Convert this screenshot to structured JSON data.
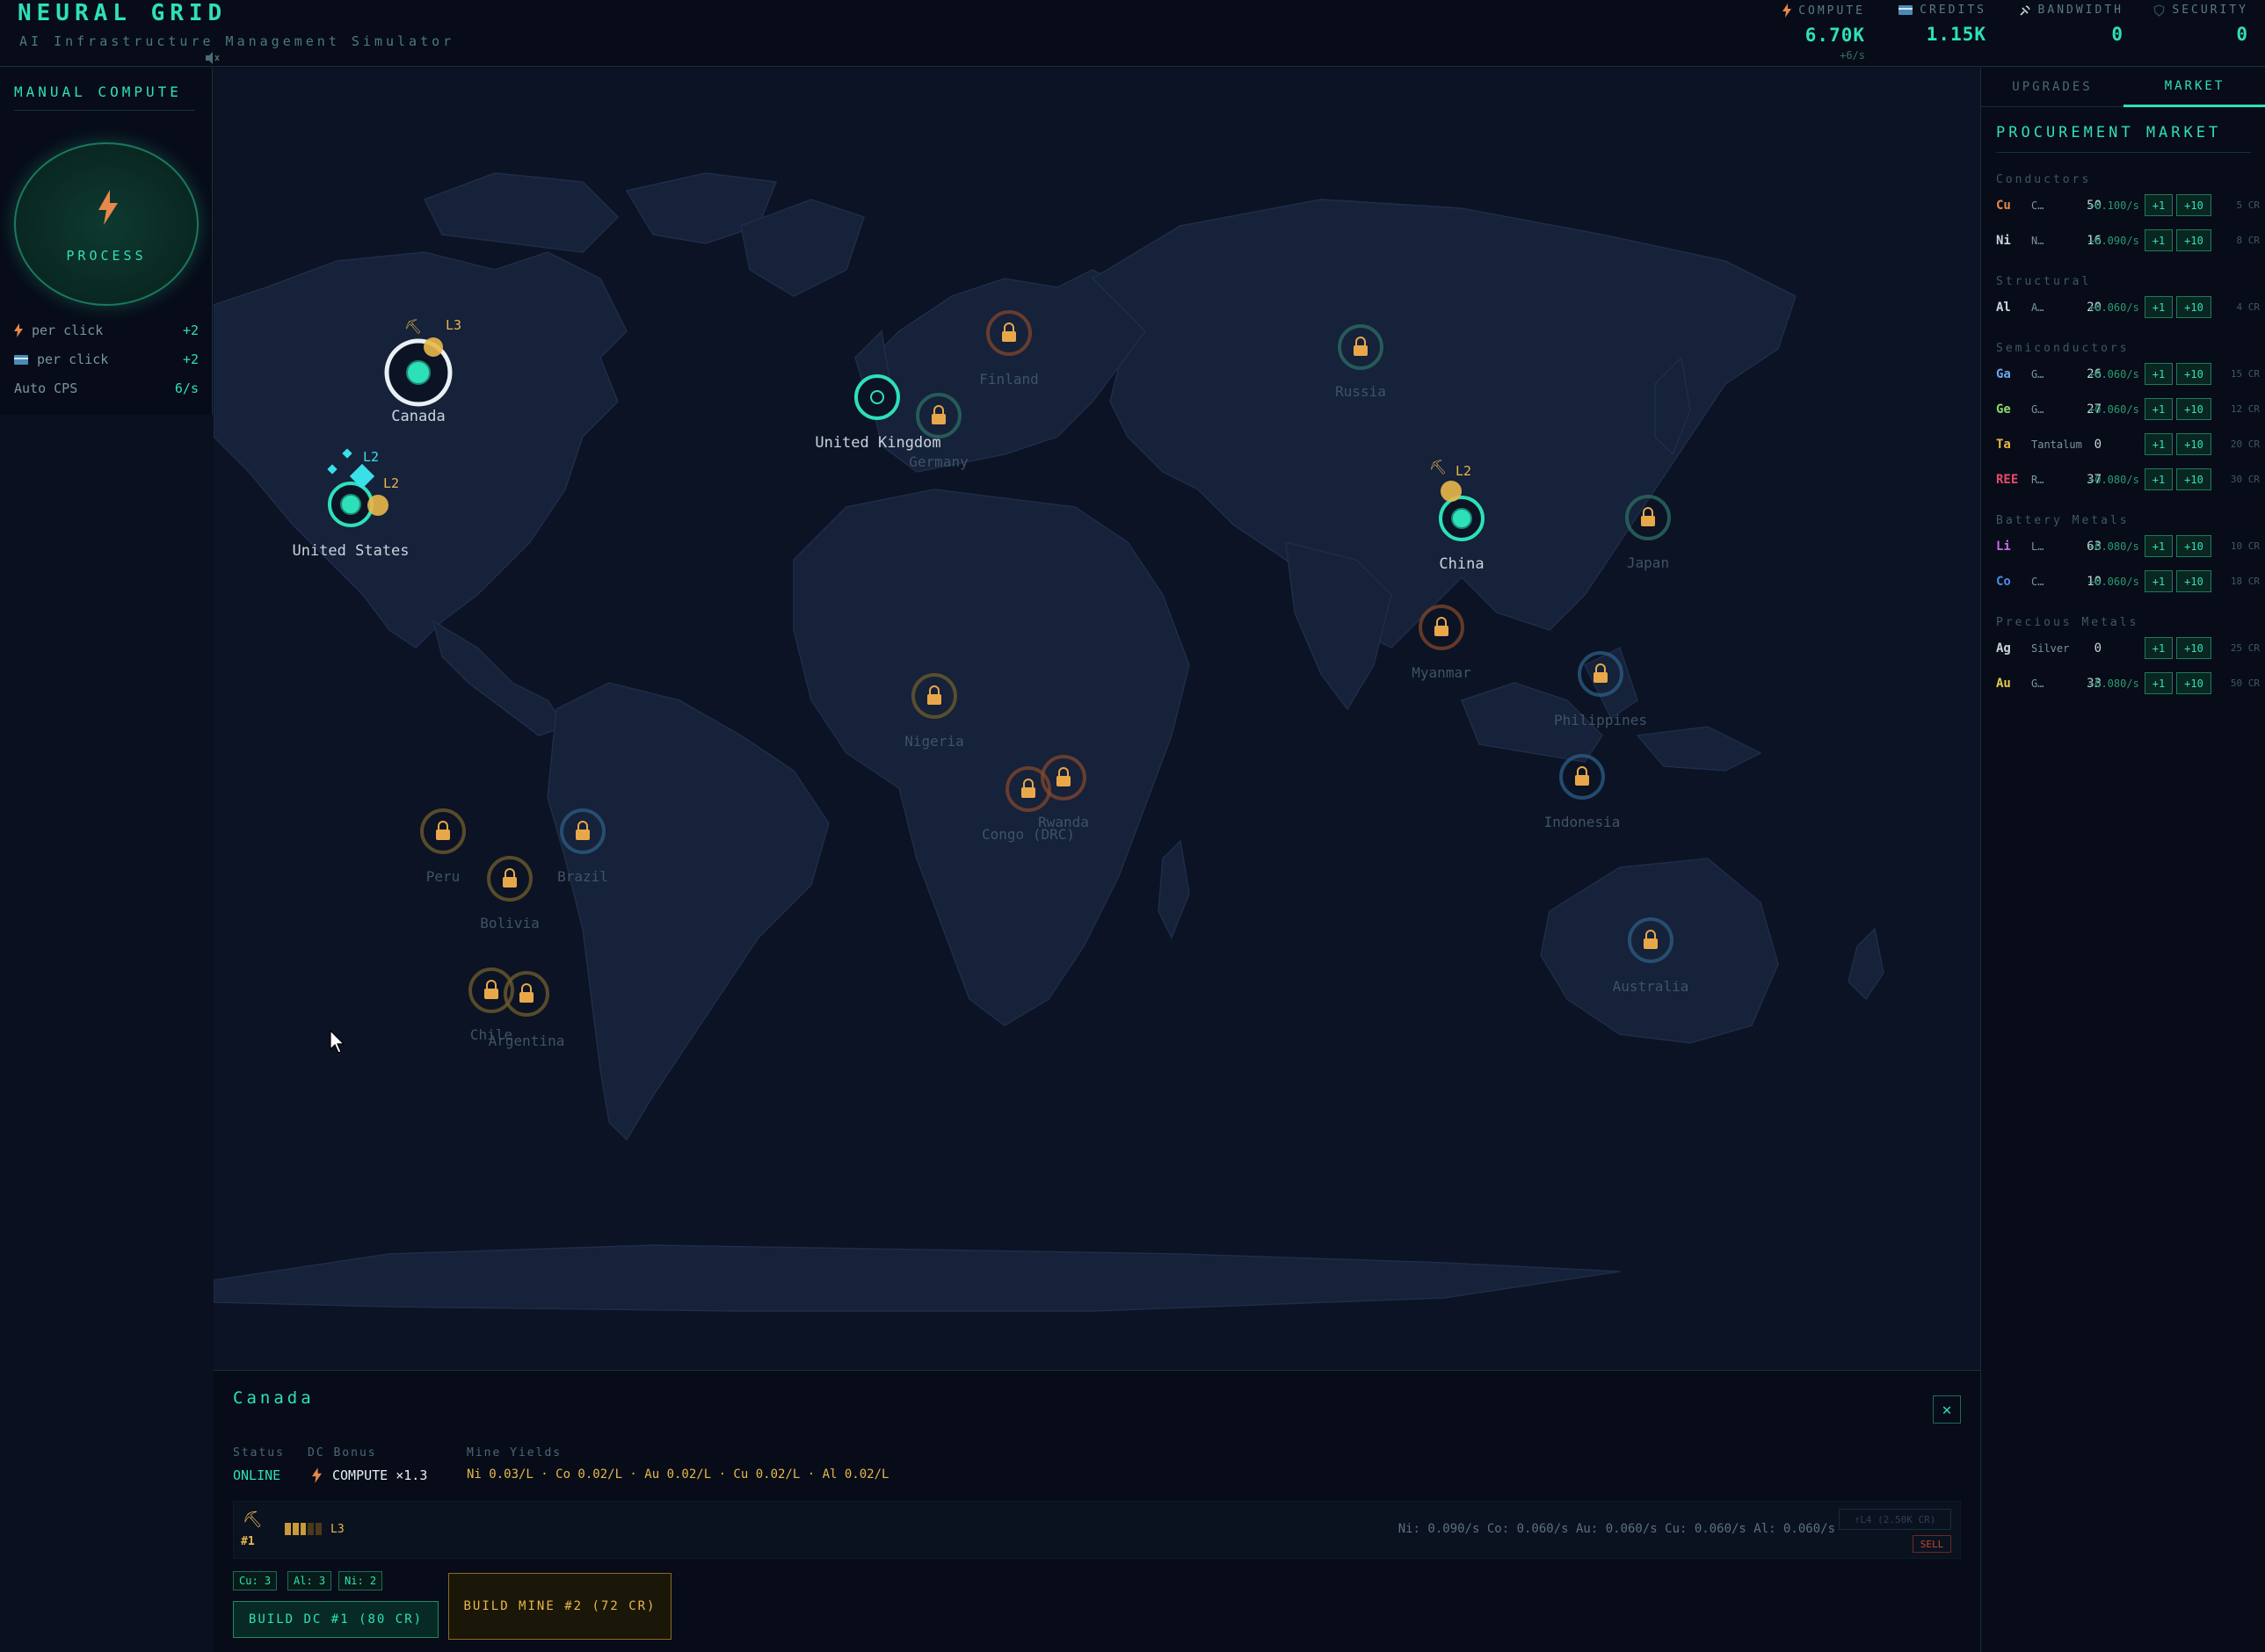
{
  "header": {
    "title": "NEURAL GRID",
    "subtitle": "AI Infrastructure Management Simulator",
    "stats": [
      {
        "label": "COMPUTE",
        "value": "6.70K",
        "sub": "+6/s",
        "icon": "lightning-icon"
      },
      {
        "label": "CREDITS",
        "value": "1.15K",
        "sub": "",
        "icon": "card-icon"
      },
      {
        "label": "BANDWIDTH",
        "value": "0",
        "sub": "",
        "icon": "satellite-icon"
      },
      {
        "label": "SECURITY",
        "value": "0",
        "sub": "",
        "icon": "shield-icon"
      }
    ]
  },
  "left_panel": {
    "title": "MANUAL COMPUTE",
    "process_label": "PROCESS",
    "rows": [
      {
        "label": "per click",
        "value": "+2",
        "icon": "lightning-icon"
      },
      {
        "label": "per click",
        "value": "+2",
        "icon": "card-icon"
      },
      {
        "label": "Auto CPS",
        "value": "6/s",
        "icon": ""
      }
    ]
  },
  "map": {
    "regions": [
      {
        "name": "Canada",
        "status": "active",
        "selected": true,
        "mine_label": "L3"
      },
      {
        "name": "United States",
        "status": "active",
        "mine_label": "L2",
        "dc_label": "L2"
      },
      {
        "name": "United Kingdom",
        "status": "active"
      },
      {
        "name": "China",
        "status": "active",
        "mine_label": "L2"
      },
      {
        "name": "Germany",
        "status": "locked"
      },
      {
        "name": "Finland",
        "status": "locked"
      },
      {
        "name": "Russia",
        "status": "locked"
      },
      {
        "name": "Japan",
        "status": "locked"
      },
      {
        "name": "Myanmar",
        "status": "locked"
      },
      {
        "name": "Philippines",
        "status": "locked"
      },
      {
        "name": "Indonesia",
        "status": "locked"
      },
      {
        "name": "Australia",
        "status": "locked"
      },
      {
        "name": "Nigeria",
        "status": "locked"
      },
      {
        "name": "Congo (DRC)",
        "status": "locked"
      },
      {
        "name": "Rwanda",
        "status": "locked"
      },
      {
        "name": "Peru",
        "status": "locked"
      },
      {
        "name": "Brazil",
        "status": "locked"
      },
      {
        "name": "Bolivia",
        "status": "locked"
      },
      {
        "name": "Chile",
        "status": "locked"
      },
      {
        "name": "Argentina",
        "status": "locked"
      }
    ]
  },
  "right_panel": {
    "tabs": [
      "UPGRADES",
      "MARKET"
    ],
    "active_tab": "MARKET",
    "market_title": "PROCUREMENT MARKET",
    "categories": [
      {
        "name": "Conductors",
        "items": [
          {
            "sym": "Cu",
            "name": "C…",
            "qty": "50",
            "rate": "+0.100/s",
            "price": "5 CR",
            "color": "#e8884a"
          },
          {
            "sym": "Ni",
            "name": "N…",
            "qty": "16",
            "rate": "+0.090/s",
            "price": "8 CR",
            "color": "#c8d4da"
          }
        ]
      },
      {
        "name": "Structural",
        "items": [
          {
            "sym": "Al",
            "name": "A…",
            "qty": "20",
            "rate": "+0.060/s",
            "price": "4 CR",
            "color": "#c8d4da"
          }
        ]
      },
      {
        "name": "Semiconductors",
        "items": [
          {
            "sym": "Ga",
            "name": "G…",
            "qty": "26",
            "rate": "+0.060/s",
            "price": "15 CR",
            "color": "#6aa8e8"
          },
          {
            "sym": "Ge",
            "name": "G…",
            "qty": "27",
            "rate": "+0.060/s",
            "price": "12 CR",
            "color": "#8ad86a"
          },
          {
            "sym": "Ta",
            "name": "Tantalum",
            "qty": "0",
            "rate": "",
            "price": "20 CR",
            "color": "#e8b84a"
          },
          {
            "sym": "REE",
            "name": "R…",
            "qty": "37",
            "rate": "+0.080/s",
            "price": "30 CR",
            "color": "#e84a6a"
          }
        ]
      },
      {
        "name": "Battery Metals",
        "items": [
          {
            "sym": "Li",
            "name": "L…",
            "qty": "63",
            "rate": "+0.080/s",
            "price": "10 CR",
            "color": "#c86ae8"
          },
          {
            "sym": "Co",
            "name": "C…",
            "qty": "10",
            "rate": "+0.060/s",
            "price": "18 CR",
            "color": "#4a8ae8"
          }
        ]
      },
      {
        "name": "Precious Metals",
        "items": [
          {
            "sym": "Ag",
            "name": "Silver",
            "qty": "0",
            "rate": "",
            "price": "25 CR",
            "color": "#c8d4da"
          },
          {
            "sym": "Au",
            "name": "G…",
            "qty": "33",
            "rate": "+0.080/s",
            "price": "50 CR",
            "color": "#e8c84a"
          }
        ]
      }
    ],
    "btn1": "+1",
    "btn10": "+10"
  },
  "bottom_panel": {
    "region": "Canada",
    "status_label": "Status",
    "status_value": "ONLINE",
    "dc_bonus_label": "DC Bonus",
    "dc_bonus_value": "COMPUTE ×1.3",
    "yields_label": "Mine Yields",
    "yields_value": "Ni 0.03/L · Co 0.02/L · Au 0.02/L · Cu 0.02/L · Al 0.02/L",
    "mine": {
      "number": "#1",
      "level": "L3",
      "level_fraction": 0.6,
      "output": "Ni: 0.090/s Co: 0.060/s Au: 0.060/s Cu: 0.060/s Al: 0.060/s",
      "upgrade_label": "↑L4 (2.50K CR)",
      "sell_label": "SELL"
    },
    "resource_chips": [
      "Cu: 3",
      "Al: 3",
      "Ni: 2"
    ],
    "build_dc_label": "BUILD DC #1 (80 CR)",
    "build_mine_label": "BUILD MINE #2 (72 CR)",
    "close_label": "✕"
  }
}
